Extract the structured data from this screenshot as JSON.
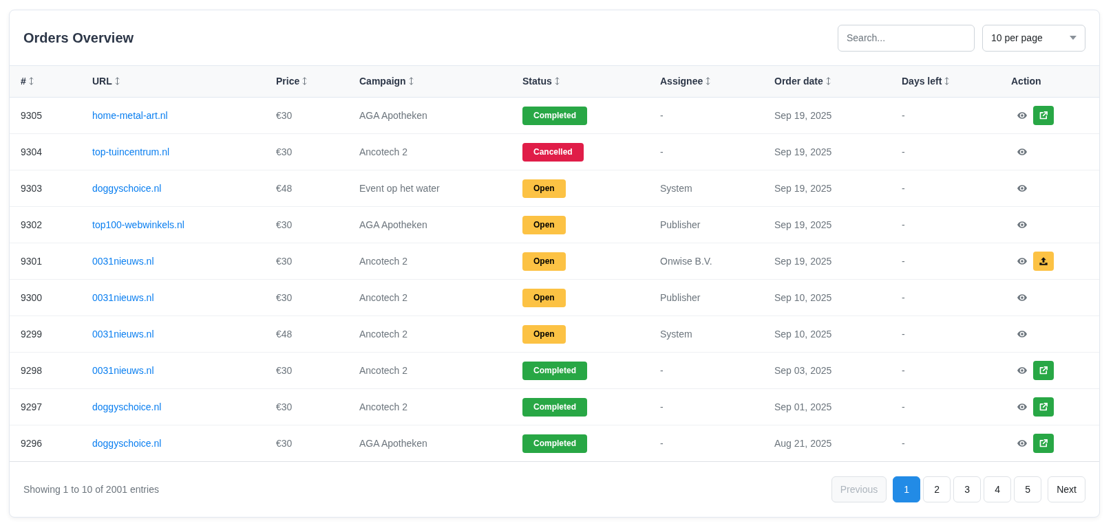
{
  "header": {
    "title": "Orders Overview",
    "search": {
      "placeholder": "Search..."
    },
    "page_size": {
      "value": "10 per page"
    }
  },
  "table": {
    "columns": [
      {
        "label": "#",
        "sortable": true
      },
      {
        "label": "URL",
        "sortable": true
      },
      {
        "label": "Price",
        "sortable": true
      },
      {
        "label": "Campaign",
        "sortable": true
      },
      {
        "label": "Status",
        "sortable": true
      },
      {
        "label": "Assignee",
        "sortable": true
      },
      {
        "label": "Order date",
        "sortable": true
      },
      {
        "label": "Days left",
        "sortable": true
      },
      {
        "label": "Action",
        "sortable": false
      }
    ],
    "rows": [
      {
        "number": "9305",
        "url": "home-metal-art.nl",
        "price": "€30",
        "campaign": "AGA Apotheken",
        "status": {
          "label": "Completed",
          "color": "#28a745"
        },
        "assignee": "-",
        "order_date": "Sep 19, 2025",
        "days_left": "-",
        "actions": [
          {
            "kind": "view"
          },
          {
            "kind": "open-link"
          }
        ]
      },
      {
        "number": "9304",
        "url": "top-tuincentrum.nl",
        "price": "€30",
        "campaign": "Ancotech 2",
        "status": {
          "label": "Cancelled",
          "color": "#e01d48"
        },
        "assignee": "-",
        "order_date": "Sep 19, 2025",
        "days_left": "-",
        "actions": [
          {
            "kind": "view"
          }
        ]
      },
      {
        "number": "9303",
        "url": "doggyschoice.nl",
        "price": "€48",
        "campaign": "Event op het water",
        "status": {
          "label": "Open",
          "color": "#fcc244"
        },
        "assignee": "System",
        "order_date": "Sep 19, 2025",
        "days_left": "-",
        "actions": [
          {
            "kind": "view"
          }
        ]
      },
      {
        "number": "9302",
        "url": "top100-webwinkels.nl",
        "price": "€30",
        "campaign": "AGA Apotheken",
        "status": {
          "label": "Open",
          "color": "#fcc244"
        },
        "assignee": "Publisher",
        "order_date": "Sep 19, 2025",
        "days_left": "-",
        "actions": [
          {
            "kind": "view"
          }
        ]
      },
      {
        "number": "9301",
        "url": "0031nieuws.nl",
        "price": "€30",
        "campaign": "Ancotech 2",
        "status": {
          "label": "Open",
          "color": "#fcc244"
        },
        "assignee": "Onwise B.V.",
        "order_date": "Sep 19, 2025",
        "days_left": "-",
        "actions": [
          {
            "kind": "view"
          },
          {
            "kind": "upload"
          }
        ]
      },
      {
        "number": "9300",
        "url": "0031nieuws.nl",
        "price": "€30",
        "campaign": "Ancotech 2",
        "status": {
          "label": "Open",
          "color": "#fcc244"
        },
        "assignee": "Publisher",
        "order_date": "Sep 10, 2025",
        "days_left": "-",
        "actions": [
          {
            "kind": "view"
          }
        ]
      },
      {
        "number": "9299",
        "url": "0031nieuws.nl",
        "price": "€48",
        "campaign": "Ancotech 2",
        "status": {
          "label": "Open",
          "color": "#fcc244"
        },
        "assignee": "System",
        "order_date": "Sep 10, 2025",
        "days_left": "-",
        "actions": [
          {
            "kind": "view"
          }
        ]
      },
      {
        "number": "9298",
        "url": "0031nieuws.nl",
        "price": "€30",
        "campaign": "Ancotech 2",
        "status": {
          "label": "Completed",
          "color": "#28a745"
        },
        "assignee": "-",
        "order_date": "Sep 03, 2025",
        "days_left": "-",
        "actions": [
          {
            "kind": "view"
          },
          {
            "kind": "open-link"
          }
        ]
      },
      {
        "number": "9297",
        "url": "doggyschoice.nl",
        "price": "€30",
        "campaign": "Ancotech 2",
        "status": {
          "label": "Completed",
          "color": "#28a745"
        },
        "assignee": "-",
        "order_date": "Sep 01, 2025",
        "days_left": "-",
        "actions": [
          {
            "kind": "view"
          },
          {
            "kind": "open-link"
          }
        ]
      },
      {
        "number": "9296",
        "url": "doggyschoice.nl",
        "price": "€30",
        "campaign": "AGA Apotheken",
        "status": {
          "label": "Completed",
          "color": "#28a745"
        },
        "assignee": "-",
        "order_date": "Aug 21, 2025",
        "days_left": "-",
        "actions": [
          {
            "kind": "view"
          },
          {
            "kind": "open-link"
          }
        ]
      }
    ]
  },
  "footer": {
    "summary": "Showing 1 to 10 of 2001 entries",
    "pagination": {
      "previous": {
        "label": "Previous",
        "disabled": true
      },
      "pages": [
        {
          "label": "1",
          "selected": true
        },
        {
          "label": "2",
          "selected": false
        },
        {
          "label": "3",
          "selected": false
        },
        {
          "label": "4",
          "selected": false
        },
        {
          "label": "5",
          "selected": false
        }
      ],
      "next": {
        "label": "Next",
        "disabled": false
      }
    }
  }
}
